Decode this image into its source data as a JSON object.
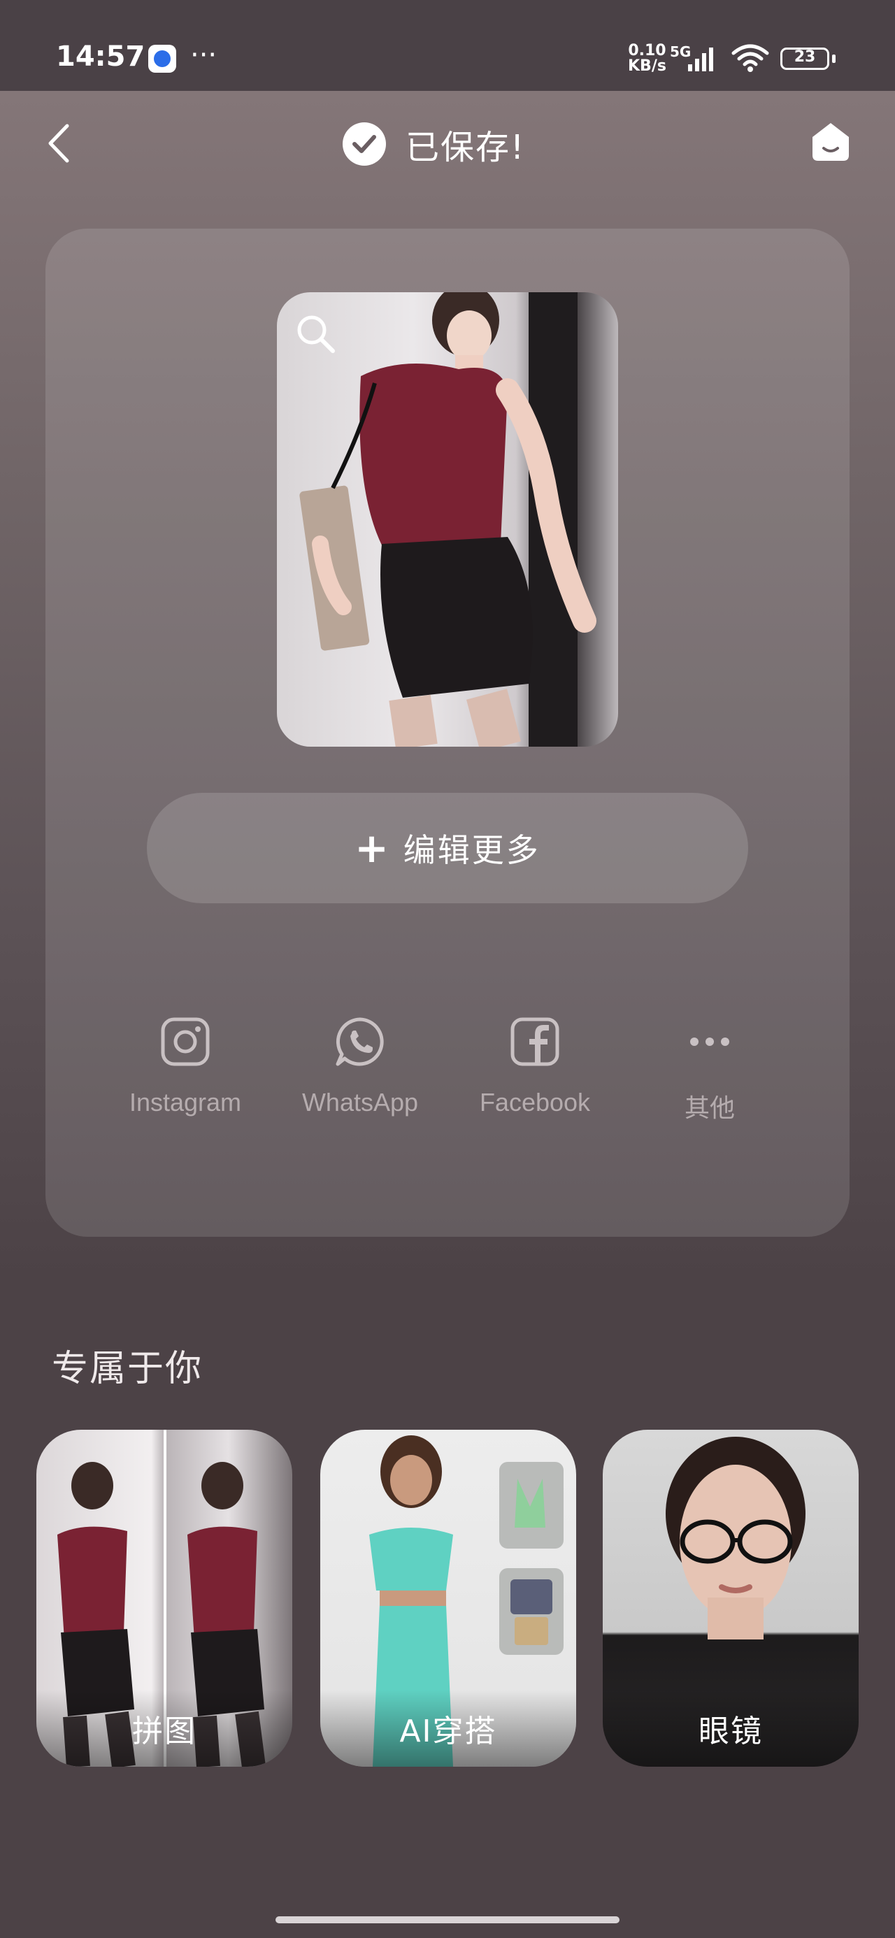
{
  "status_bar": {
    "time": "14:57",
    "more": "···",
    "net_speed_value": "0.10",
    "net_speed_unit": "KB/s",
    "network": "5G",
    "battery": "23"
  },
  "header": {
    "title": "已保存!"
  },
  "editor": {
    "edit_more_label": "编辑更多",
    "share": [
      {
        "name": "instagram",
        "label": "Instagram",
        "icon": "instagram-icon"
      },
      {
        "name": "whatsapp",
        "label": "WhatsApp",
        "icon": "whatsapp-icon"
      },
      {
        "name": "facebook",
        "label": "Facebook",
        "icon": "facebook-icon"
      },
      {
        "name": "other",
        "label": "其他",
        "icon": "more-dots-icon"
      }
    ]
  },
  "for_you": {
    "title": "专属于你",
    "items": [
      {
        "label": "拼图"
      },
      {
        "label": "AI穿搭"
      },
      {
        "label": "眼镜"
      }
    ]
  },
  "colors": {
    "background": "#4c4246",
    "card": "rgba(255,255,255,0.13)",
    "share_label": "#b5acae",
    "accent_red": "#7a2233"
  }
}
